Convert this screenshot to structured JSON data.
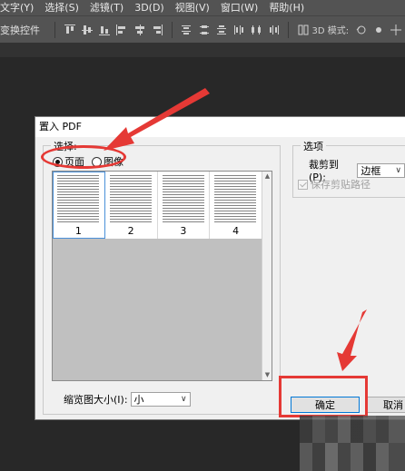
{
  "menubar": {
    "items": [
      "文字(Y)",
      "选择(S)",
      "滤镜(T)",
      "3D(D)",
      "视图(V)",
      "窗口(W)",
      "帮助(H)"
    ]
  },
  "optionsbar": {
    "label": "变换控件",
    "icons": [
      "align-top-edges-icon",
      "align-vertical-centers-icon",
      "align-bottom-edges-icon",
      "align-left-edges-icon",
      "align-horizontal-centers-icon",
      "align-right-edges-icon",
      "distribute-top-icon",
      "distribute-vcenter-icon",
      "distribute-bottom-icon",
      "distribute-left-icon",
      "distribute-hcenter-icon",
      "distribute-right-icon",
      "auto-align-icon"
    ],
    "mode_3d_label": "3D 模式:"
  },
  "dialog": {
    "title": "置入 PDF",
    "select_group_title": "选择:",
    "radio_page": "页面",
    "radio_image": "图像",
    "selected_radio": "页面",
    "thumbnails": [
      "1",
      "2",
      "3",
      "4"
    ],
    "thumb_size_label": "缩览图大小(I):",
    "thumb_size_value": "小",
    "options_group_title": "选项",
    "crop_to_label": "裁剪到(P):",
    "crop_to_value": "边框",
    "save_clip_path_label": "保存剪贴路径",
    "save_clip_path_checked": true,
    "ok_button": "确定",
    "cancel_button": "取消"
  },
  "colors": {
    "annotation_red": "#e53935",
    "menubar_bg": "#535353",
    "workarea_bg": "#282828",
    "dialog_bg": "#f0f0f0"
  }
}
